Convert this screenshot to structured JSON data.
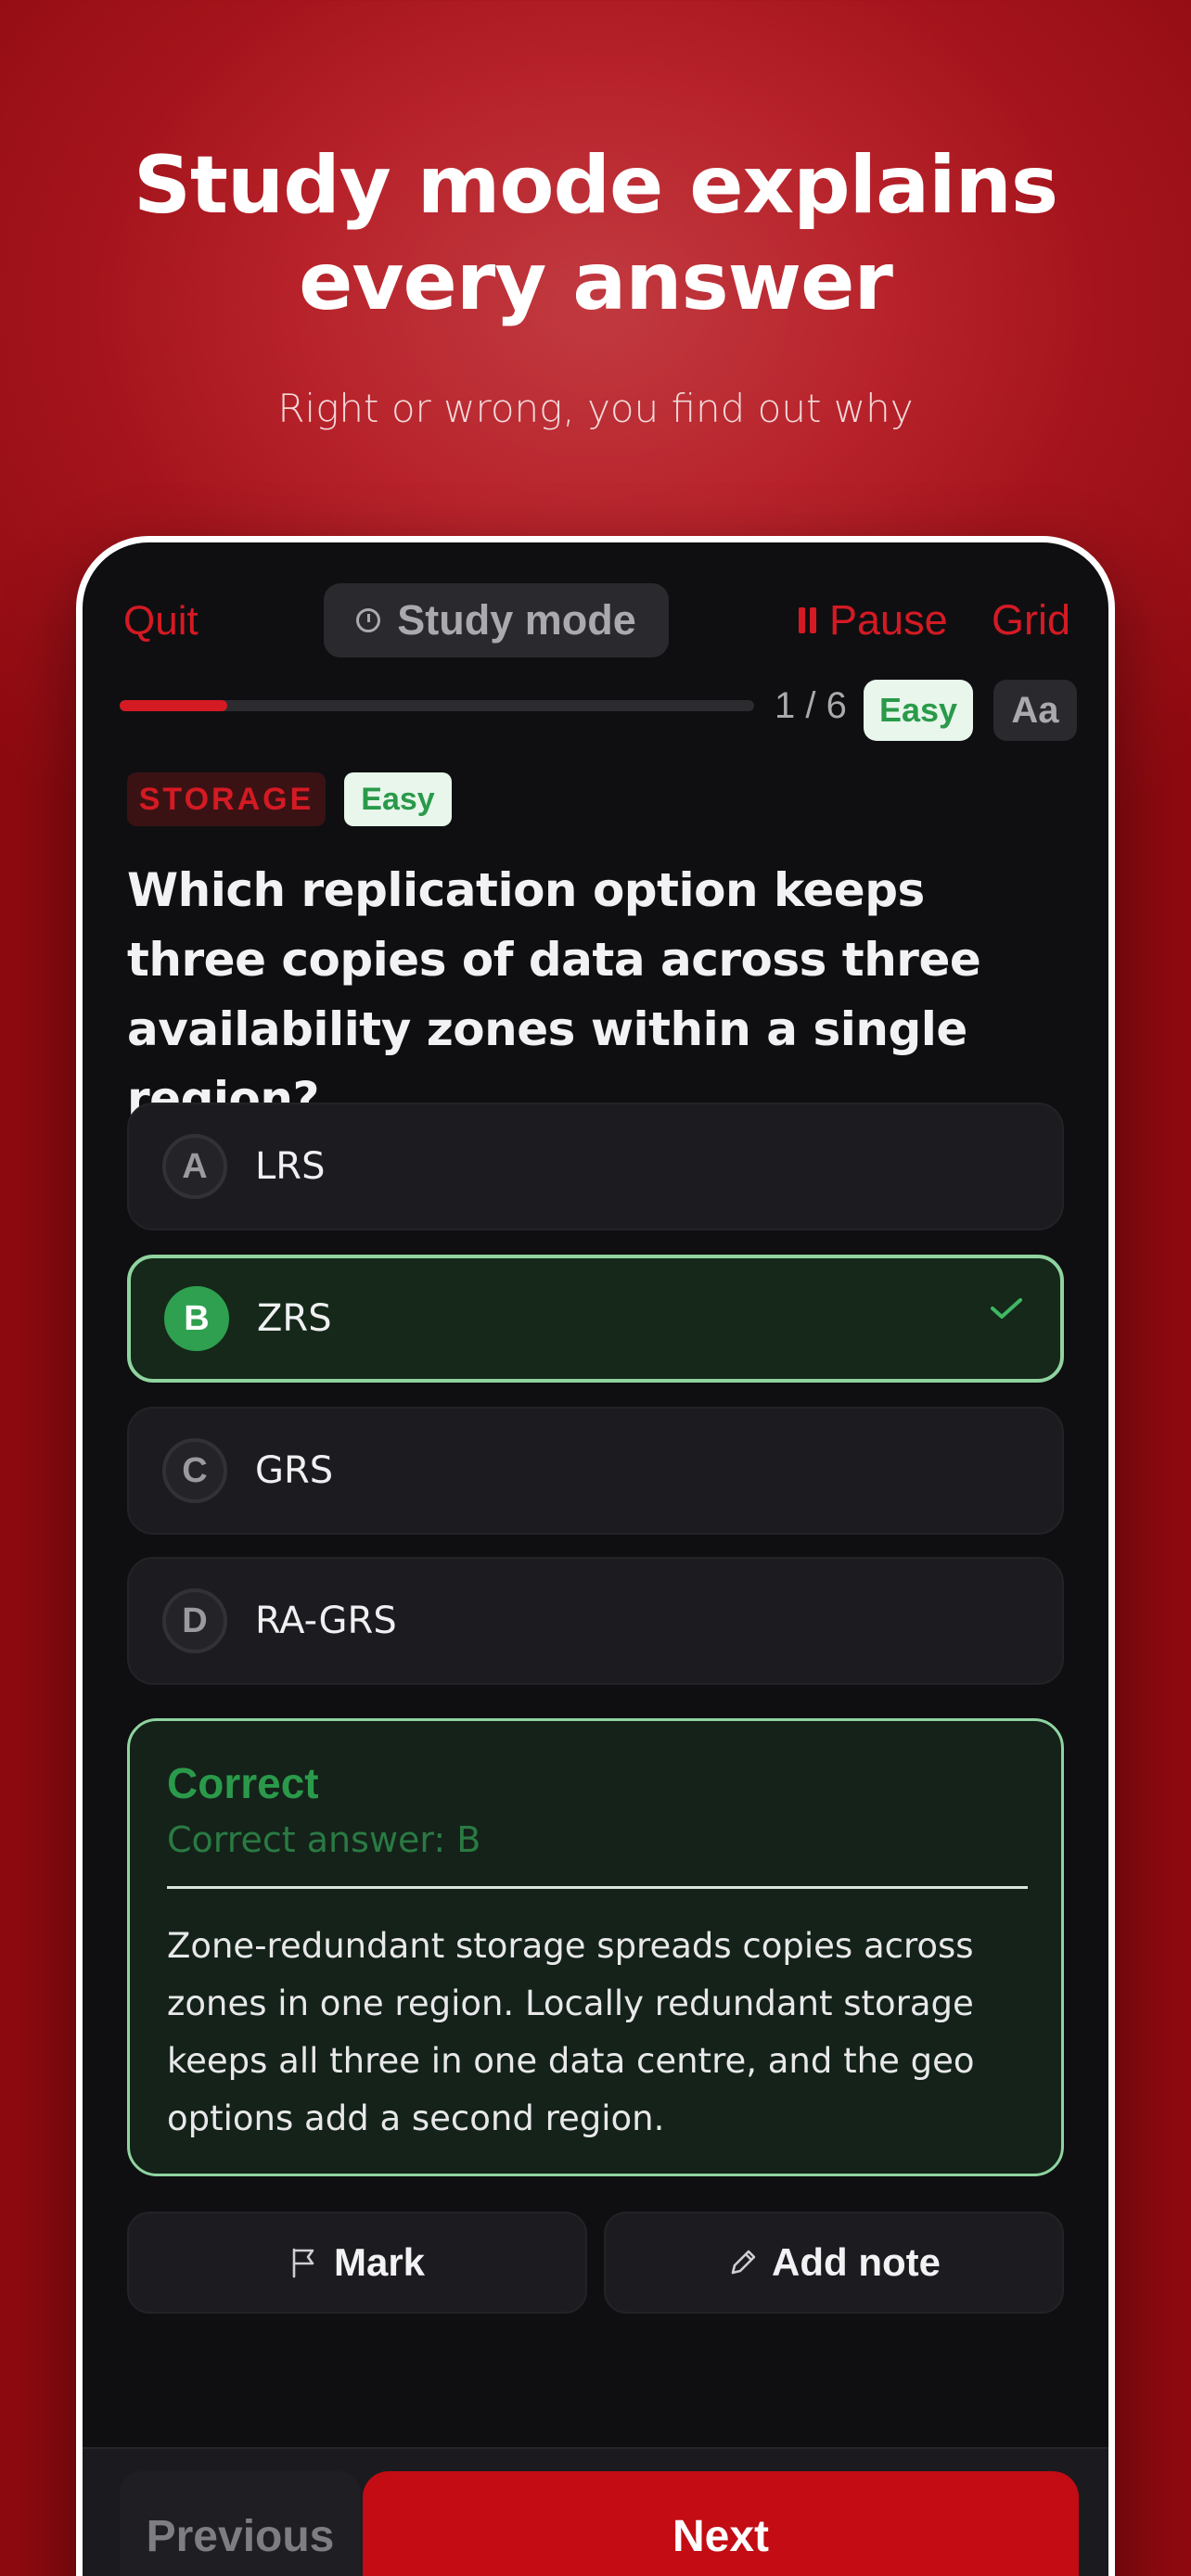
{
  "hero": {
    "title_line1": "Study mode explains",
    "title_line2": "every answer",
    "subtitle": "Right or wrong, you find out why"
  },
  "topbar": {
    "quit_label": "Quit",
    "mode_label": "Study mode",
    "pause_label": "Pause",
    "grid_label": "Grid"
  },
  "progress": {
    "current": 1,
    "total": 6,
    "counter_text": "1 / 6",
    "fraction": 0.17,
    "difficulty": "Easy",
    "font_button": "Aa"
  },
  "question": {
    "category": "STORAGE",
    "difficulty": "Easy",
    "text": "Which replication option keeps three copies of data across three availability zones within a single region?",
    "options": [
      {
        "letter": "A",
        "text": "LRS"
      },
      {
        "letter": "B",
        "text": "ZRS"
      },
      {
        "letter": "C",
        "text": "GRS"
      },
      {
        "letter": "D",
        "text": "RA-GRS"
      }
    ],
    "selected": "B"
  },
  "feedback": {
    "title": "Correct",
    "answer_line": "Correct answer: B",
    "explanation": "Zone-redundant storage spreads copies across zones in one region. Locally redundant storage keeps all three in one data centre, and the geo options add a second region."
  },
  "actions": {
    "mark_label": "Mark",
    "note_label": "Add note"
  },
  "footer": {
    "previous_label": "Previous",
    "next_label": "Next"
  },
  "colors": {
    "accent_red": "#d41a23",
    "correct_green": "#2a9a4a",
    "background": "#0f0f12"
  },
  "icons": {
    "timer": "stopwatch-icon",
    "pause": "pause-icon",
    "check": "checkmark-icon",
    "mark": "flag-icon",
    "note": "pencil-icon"
  }
}
